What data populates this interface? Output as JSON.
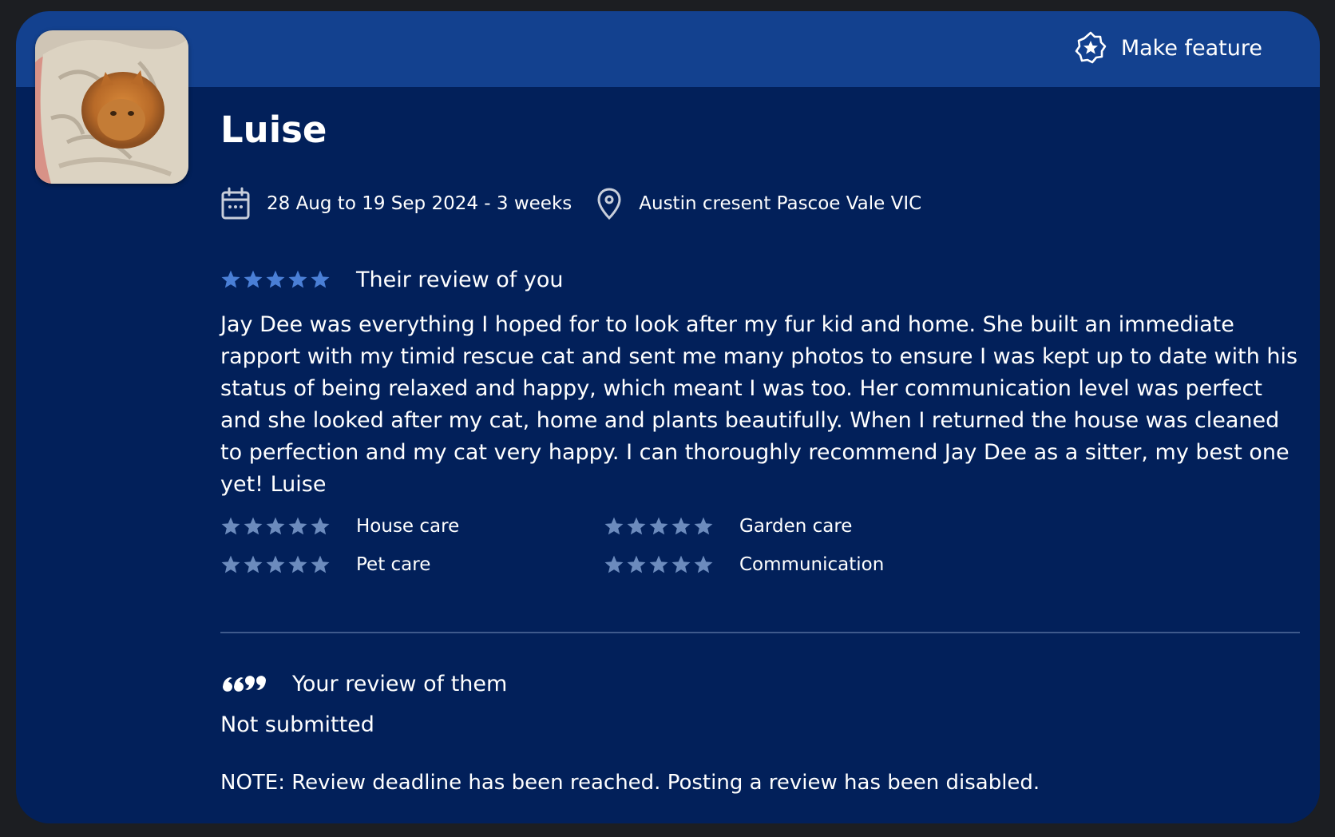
{
  "header": {
    "feature_label": "Make feature",
    "feature_icon": "star-badge-icon"
  },
  "reviewer": {
    "name": "Luise",
    "avatar": "cat-photo"
  },
  "stay": {
    "dates": "28 Aug to 19 Sep 2024 - 3 weeks",
    "location": "Austin cresent Pascoe Vale VIC"
  },
  "their_review": {
    "label": "Their review of you",
    "rating": 5,
    "text": "Jay Dee was everything I hoped for to look after my fur kid and home. She built an immediate rapport with my timid rescue cat and sent me many photos to ensure I was kept up to date with his status of being relaxed and happy, which meant I was too. Her communication level was perfect and she looked after my cat, home and plants beautifully. When I returned the house was cleaned to perfection and my cat very happy. I can thoroughly recommend Jay Dee as a sitter, my best one yet! Luise"
  },
  "ratings": [
    {
      "label": "House care",
      "stars": 5
    },
    {
      "label": "Garden care",
      "stars": 5
    },
    {
      "label": "Pet care",
      "stars": 5
    },
    {
      "label": "Communication",
      "stars": 5
    }
  ],
  "your_review": {
    "label": "Your review of them",
    "status": "Not submitted",
    "note": "NOTE: Review deadline has been reached. Posting a review has been disabled."
  },
  "colors": {
    "card_bg": "#02205a",
    "header_bg": "#13418f",
    "star_primary": "#4a7fd6",
    "star_muted": "#6c8bbd"
  }
}
